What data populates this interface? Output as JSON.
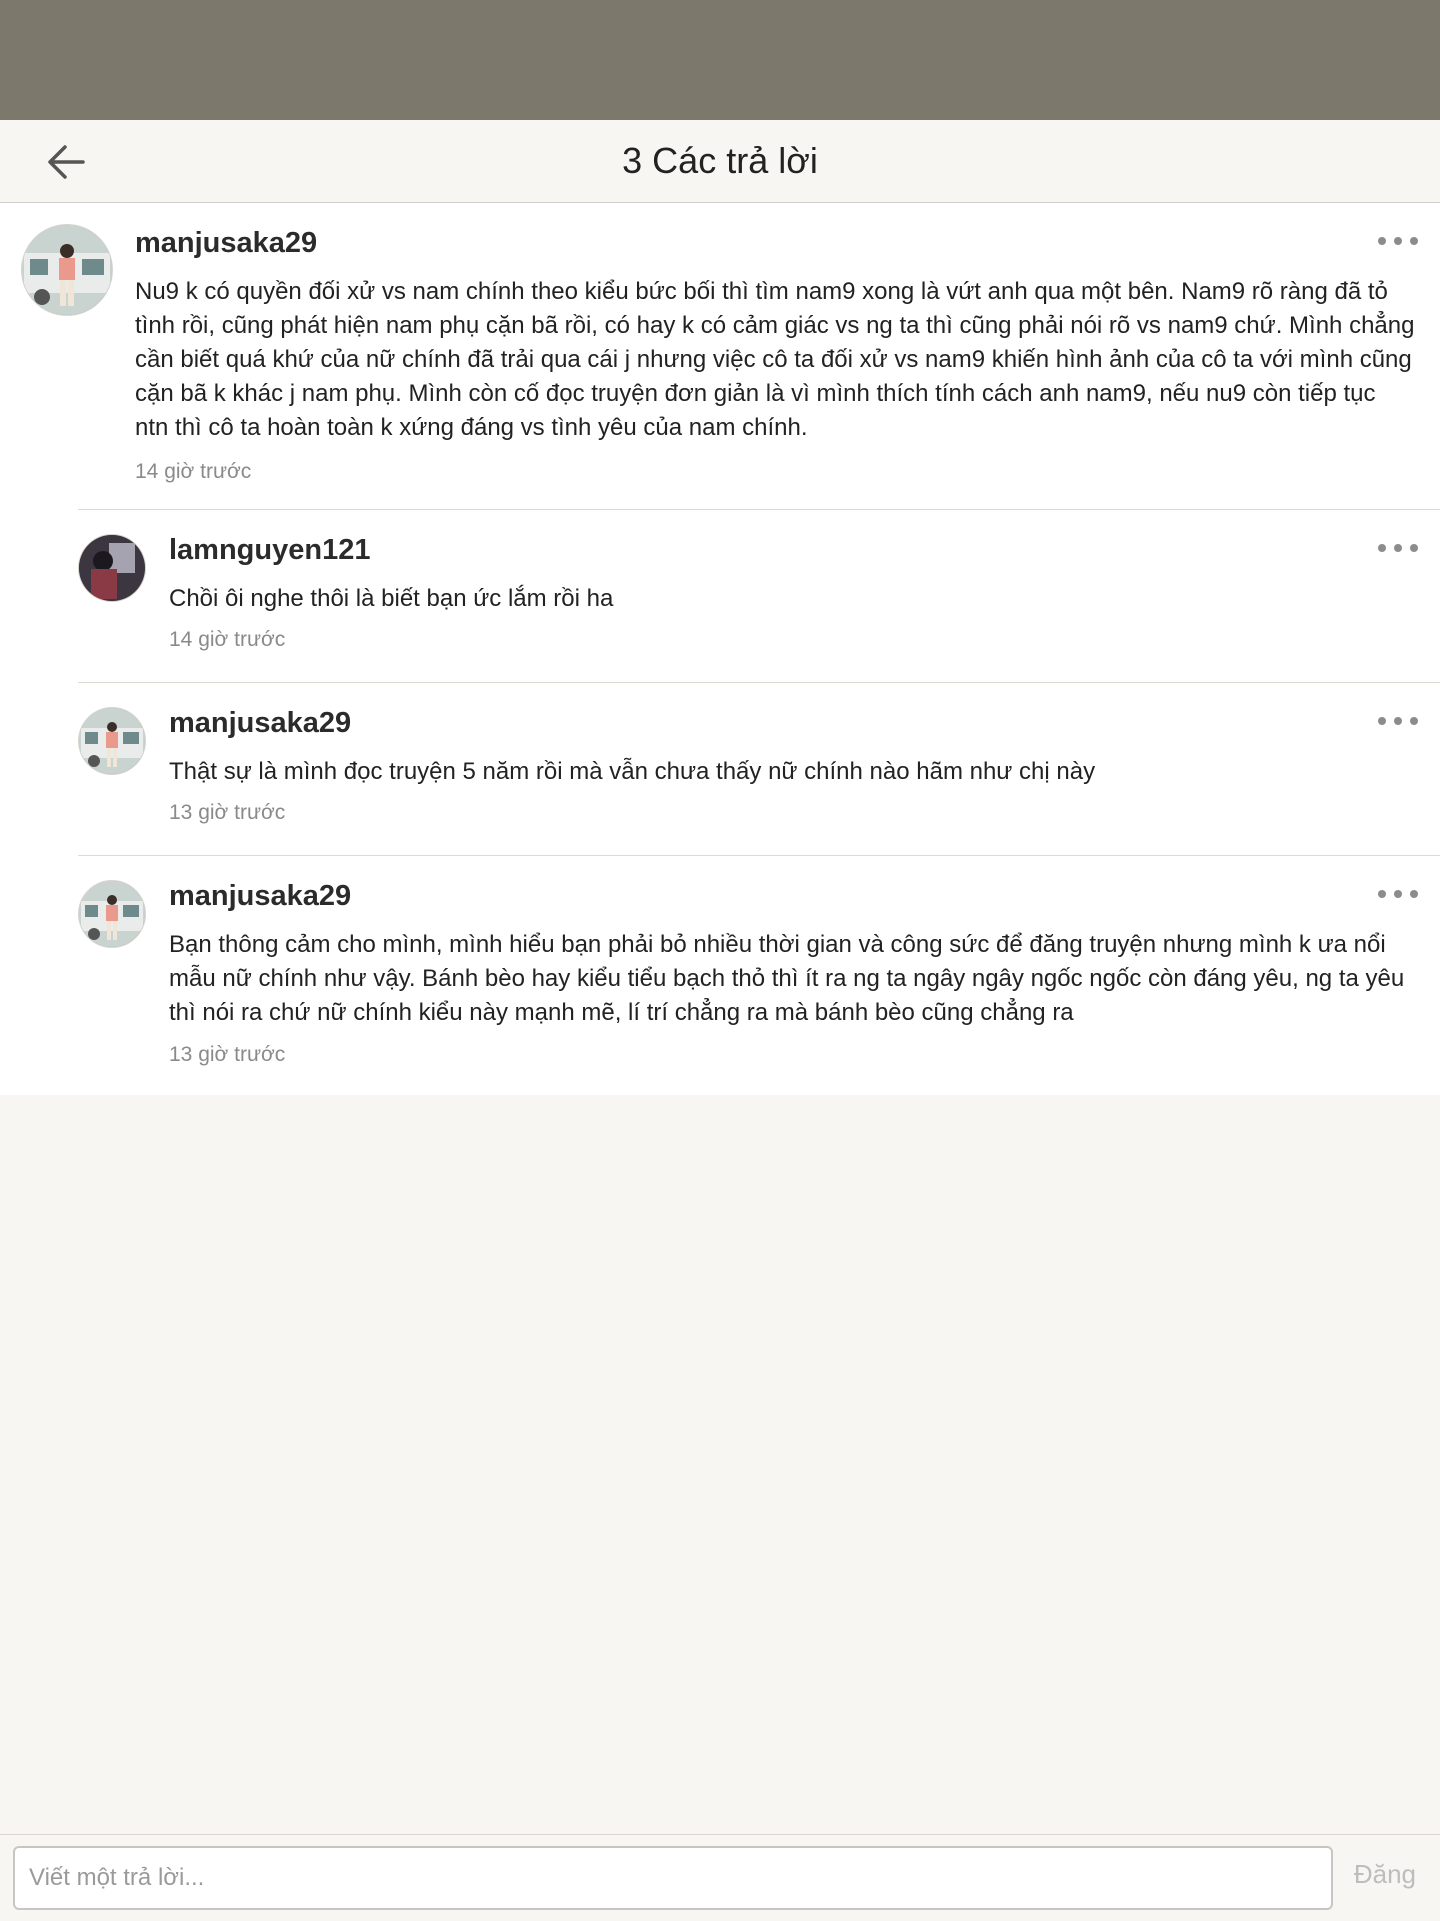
{
  "header": {
    "title": "3 Các trả lời"
  },
  "comments": [
    {
      "username": "manjusaka29",
      "text": "Nu9 k có quyền đối xử vs nam chính theo kiểu bức bối thì tìm nam9 xong là vứt anh qua một bên. Nam9 rõ ràng đã tỏ tình rồi, cũng phát hiện nam phụ cặn bã rồi, có hay k có cảm giác vs ng ta thì cũng phải nói rõ vs nam9 chứ. Mình chẳng cần biết quá khứ của nữ chính đã trải qua cái j nhưng việc cô ta đối xử vs nam9 khiến hình ảnh của cô ta với mình cũng cặn bã k khác j nam phụ. Mình còn cố đọc truyện đơn giản là vì mình thích tính cách anh nam9, nếu nu9 còn tiếp tục ntn thì cô ta hoàn toàn k xứng đáng vs tình yêu của nam chính.",
      "time": "14 giờ trước"
    },
    {
      "username": "lamnguyen121",
      "text": "Chồi ôi nghe thôi là biết bạn ức lắm rồi ha",
      "time": "14 giờ trước"
    },
    {
      "username": "manjusaka29",
      "text": "Thật sự là mình đọc truyện 5 năm rồi mà vẫn chưa thấy nữ chính nào hãm như chị này",
      "time": "13 giờ trước"
    },
    {
      "username": "manjusaka29",
      "text": "Bạn thông cảm cho mình, mình hiểu bạn phải bỏ nhiều thời gian và công sức để đăng truyện nhưng mình k ưa nổi mẫu nữ chính như vậy. Bánh bèo hay kiểu tiểu bạch thỏ thì ít ra ng ta ngây ngây ngốc ngốc còn đáng yêu, ng ta yêu thì nói ra chứ nữ chính kiểu này mạnh mẽ, lí trí chẳng ra mà bánh bèo cũng chẳng ra",
      "time": "13 giờ trước"
    }
  ],
  "composer": {
    "placeholder": "Viết một trả lời...",
    "post_label": "Đăng"
  },
  "colors": {
    "status_bar": "#7c786b",
    "background": "#f7f6f2",
    "disabled_button": "#bdbdbd"
  }
}
